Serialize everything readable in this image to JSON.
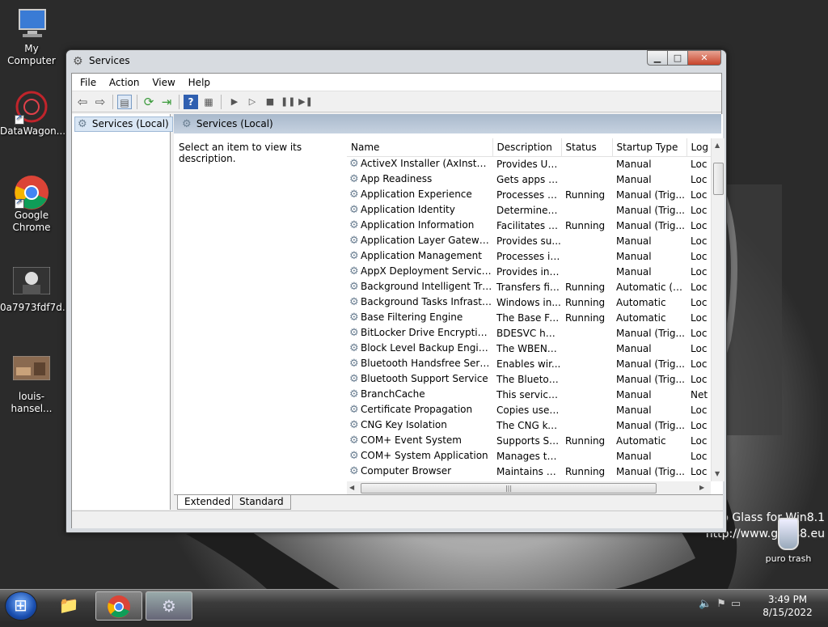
{
  "desktop": {
    "icons": [
      {
        "label": "My Computer"
      },
      {
        "label": "DataWagon..."
      },
      {
        "label": "Google Chrome"
      },
      {
        "label": "0a7973fdf7d..."
      },
      {
        "label": "louis-hansel..."
      }
    ],
    "watermark_line1": "o Glass for Win8.1",
    "watermark_line2": "http://www.glass8.eu",
    "trash_label": "puro trash"
  },
  "window": {
    "title": "Services",
    "menu": [
      "File",
      "Action",
      "View",
      "Help"
    ],
    "tree_item": "Services (Local)",
    "pane_header": "Services (Local)",
    "description_hint": "Select an item to view its description.",
    "columns": [
      "Name",
      "Description",
      "Status",
      "Startup Type",
      "Log"
    ],
    "services": [
      [
        "ActiveX Installer (AxInstSV)",
        "Provides Us...",
        "",
        "Manual",
        "Loc"
      ],
      [
        "App Readiness",
        "Gets apps re...",
        "",
        "Manual",
        "Loc"
      ],
      [
        "Application Experience",
        "Processes a...",
        "Running",
        "Manual (Trig...",
        "Loc"
      ],
      [
        "Application Identity",
        "Determines ...",
        "",
        "Manual (Trig...",
        "Loc"
      ],
      [
        "Application Information",
        "Facilitates t...",
        "Running",
        "Manual (Trig...",
        "Loc"
      ],
      [
        "Application Layer Gateway ...",
        "Provides su...",
        "",
        "Manual",
        "Loc"
      ],
      [
        "Application Management",
        "Processes in...",
        "",
        "Manual",
        "Loc"
      ],
      [
        "AppX Deployment Service (...",
        "Provides inf...",
        "",
        "Manual",
        "Loc"
      ],
      [
        "Background Intelligent Tran...",
        "Transfers fil...",
        "Running",
        "Automatic (D...",
        "Loc"
      ],
      [
        "Background Tasks Infrastru...",
        "Windows in...",
        "Running",
        "Automatic",
        "Loc"
      ],
      [
        "Base Filtering Engine",
        "The Base Fil...",
        "Running",
        "Automatic",
        "Loc"
      ],
      [
        "BitLocker Drive Encryption ...",
        "BDESVC hos...",
        "",
        "Manual (Trig...",
        "Loc"
      ],
      [
        "Block Level Backup Engine ...",
        "The WBENG...",
        "",
        "Manual",
        "Loc"
      ],
      [
        "Bluetooth Handsfree Service",
        "Enables wir...",
        "",
        "Manual (Trig...",
        "Loc"
      ],
      [
        "Bluetooth Support Service",
        "The Bluetoo...",
        "",
        "Manual (Trig...",
        "Loc"
      ],
      [
        "BranchCache",
        "This service ...",
        "",
        "Manual",
        "Net"
      ],
      [
        "Certificate Propagation",
        "Copies user ...",
        "",
        "Manual",
        "Loc"
      ],
      [
        "CNG Key Isolation",
        "The CNG ke...",
        "",
        "Manual (Trig...",
        "Loc"
      ],
      [
        "COM+ Event System",
        "Supports Sy...",
        "Running",
        "Automatic",
        "Loc"
      ],
      [
        "COM+ System Application",
        "Manages th...",
        "",
        "Manual",
        "Loc"
      ],
      [
        "Computer Browser",
        "Maintains a...",
        "Running",
        "Manual (Trig...",
        "Loc"
      ]
    ],
    "tabs": [
      "Extended",
      "Standard"
    ]
  },
  "taskbar": {
    "time": "3:49 PM",
    "date": "8/15/2022"
  }
}
